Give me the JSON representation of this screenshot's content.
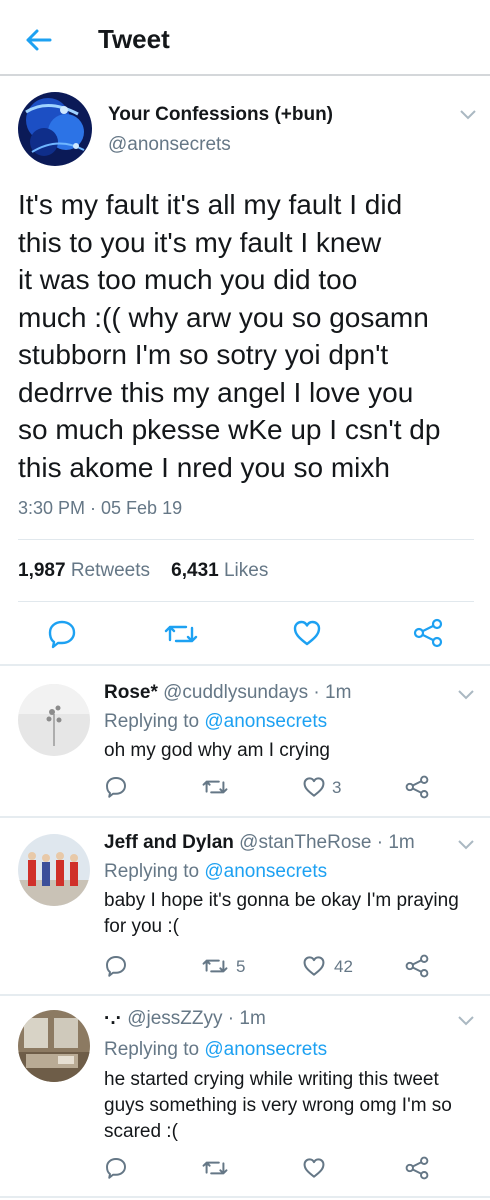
{
  "header": {
    "title": "Tweet"
  },
  "tweet": {
    "author_name": "Your Confessions (+bun)",
    "author_handle": "@anonsecrets",
    "text": "It's my fault it's all my fault I did\nthis to you it's my fault I knew\nit was too much you did too\nmuch :(( why arw you so gosamn\nstubborn I'm so sotry yoi dpn't\ndedrrve this my angel I love you\nso much pkesse wKe up I csn't dp\nthis akome I nred you so mixh",
    "timestamp": "3:30 PM · 05 Feb 19",
    "retweets_count": "1,987",
    "retweets_label": "Retweets",
    "likes_count": "6,431",
    "likes_label": "Likes"
  },
  "replies": [
    {
      "name": "Rose*",
      "handle": "@cuddlysundays",
      "age": "1m",
      "replying_prefix": "Replying to",
      "replying_to": "@anonsecrets",
      "text": "oh my god why am I crying",
      "retweets": "",
      "likes": "3"
    },
    {
      "name": "Jeff and Dylan",
      "handle": "@stanTheRose",
      "age": "1m",
      "replying_prefix": "Replying to",
      "replying_to": "@anonsecrets",
      "text": "baby I hope it's gonna be okay I'm praying for you :(",
      "retweets": "5",
      "likes": "42"
    },
    {
      "name": "·.·",
      "handle": "@jessZZyy",
      "age": "1m",
      "replying_prefix": "Replying to",
      "replying_to": "@anonsecrets",
      "text": "he started crying while writing this tweet guys something is very wrong omg I'm so scared :(",
      "retweets": "",
      "likes": ""
    }
  ],
  "colors": {
    "accent": "#1da1f2",
    "muted": "#657786",
    "text": "#14171a",
    "divider": "#e1e8ed"
  },
  "icons": [
    "back-arrow-icon",
    "chevron-down-icon",
    "reply-icon",
    "retweet-icon",
    "like-heart-icon",
    "share-icon"
  ]
}
